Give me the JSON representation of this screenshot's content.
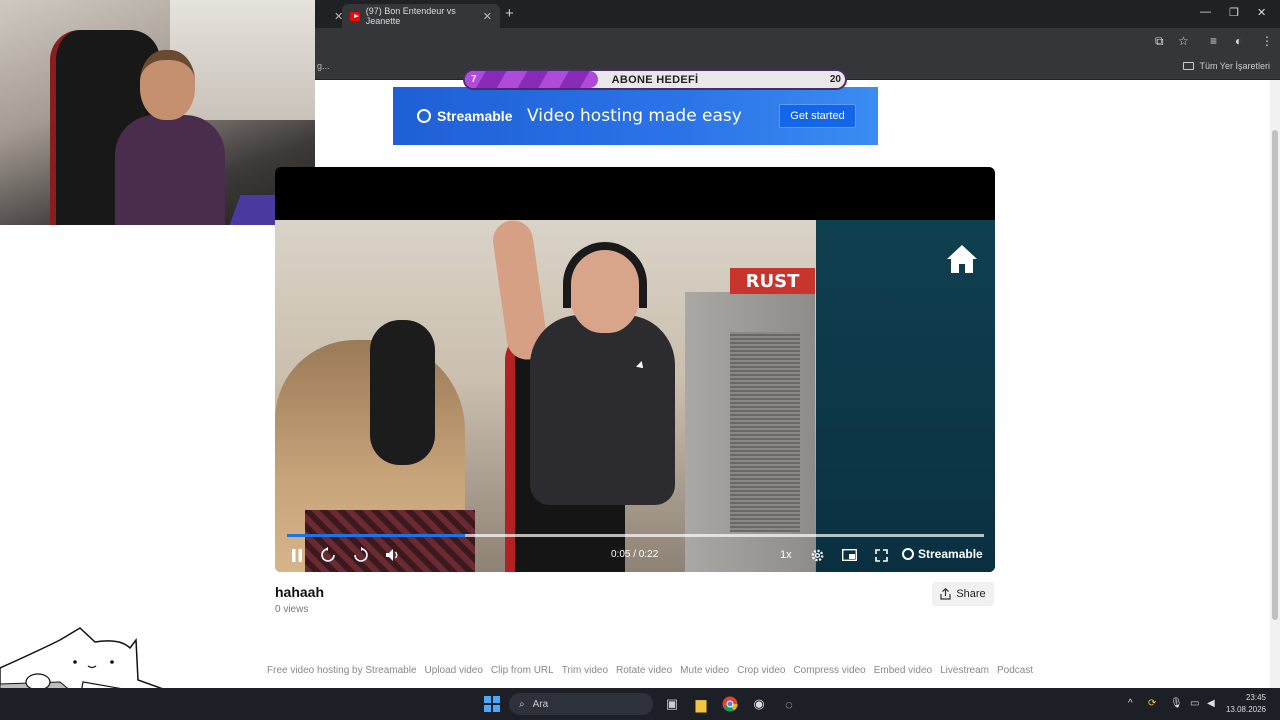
{
  "browser": {
    "tab_active_title": "(97) Bon Entendeur vs Jeanette",
    "new_tab_symbol": "+",
    "bookmark_fragment": "g...",
    "all_bookmarks_label": "Tüm Yer İşaretleri"
  },
  "goal": {
    "min": "7",
    "title": "ABONE HEDEFİ",
    "max": "20",
    "progress_fraction": 0.35
  },
  "ad": {
    "logo_text": "Streamable",
    "tagline": "Video hosting made easy",
    "cta": "Get started"
  },
  "video": {
    "rust_sign": "RUST",
    "time": "0:05 / 0:22",
    "speed": "1x",
    "brand": "Streamable",
    "progress_fraction": 0.255,
    "title": "hahaah",
    "views": "0 views",
    "share_label": "Share"
  },
  "footer": {
    "links": [
      "Free video hosting by Streamable",
      "Upload video",
      "Clip from URL",
      "Trim video",
      "Rotate video",
      "Mute video",
      "Crop video",
      "Compress video",
      "Embed video",
      "Livestream",
      "Podcast"
    ]
  },
  "taskbar": {
    "search_placeholder": "Ara",
    "time": "23:45",
    "date": "13.08.2026"
  },
  "icons": {
    "home": "home-icon",
    "pause": "pause-icon",
    "rewind": "rewind-icon",
    "forward": "forward-icon",
    "volume": "volume-icon",
    "settings": "gear-icon",
    "pip": "pip-icon",
    "fullscreen": "fullscreen-icon",
    "share": "share-icon"
  },
  "colors": {
    "accent": "#1a73e8",
    "ad_bg": "#2b74e8",
    "goal_fill": "#b04ad8"
  }
}
